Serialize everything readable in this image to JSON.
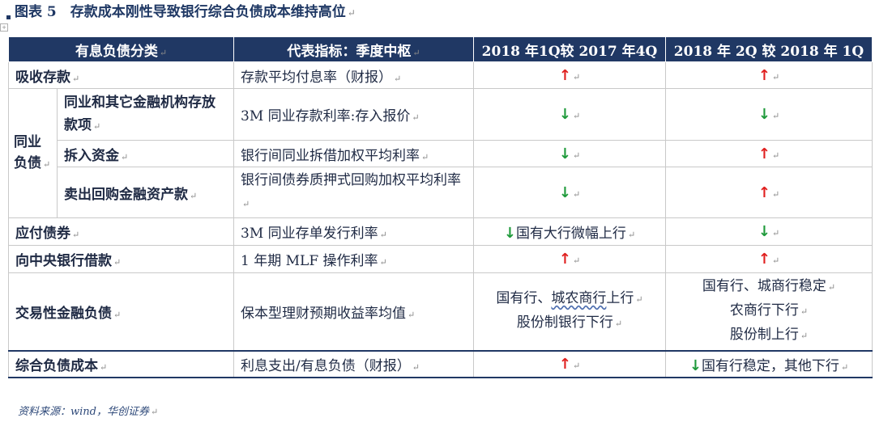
{
  "title": "图表 5　存款成本刚性导致银行综合负债成本维持高位",
  "paragraph_mark": "↵",
  "anchor_mark": "+",
  "header": {
    "col1": "有息负债分类",
    "col2": "代表指标：季度中枢",
    "col3": "2018 年1Q较 2017 年4Q",
    "col4": "2018 年 2Q 较 2018 年 1Q"
  },
  "rows": {
    "deposit": {
      "label": "吸收存款",
      "indicator": "存款平均付息率（财报）",
      "c3": "↑",
      "c4": "↑"
    },
    "interbank_group": "同业负债",
    "interbank_deposit": {
      "label": "同业和其它金融机构存放款项",
      "indicator": "3M 同业存款利率:存入报价",
      "c3": "↓",
      "c4": "↓"
    },
    "borrowing": {
      "label": "拆入资金",
      "indicator": "银行间同业拆借加权平均利率",
      "c3": "↓",
      "c4": "↑"
    },
    "repo": {
      "label": "卖出回购金融资产款",
      "indicator": "银行间债券质押式回购加权平均利率",
      "c3": "↓",
      "c4": "↑"
    },
    "bonds": {
      "label": "应付债券",
      "indicator": "3M 同业存单发行利率",
      "c3_arrow": "↓",
      "c3_text": "国有大行微幅上行",
      "c4": "↓"
    },
    "central_bank": {
      "label": "向中央银行借款",
      "indicator": "1 年期 MLF 操作利率",
      "c3": "↑",
      "c4": "↑"
    },
    "trading": {
      "label": "交易性金融负债",
      "indicator": "保本型理财预期收益率均值",
      "c3_line1_a": "国有行、",
      "c3_line1_b": "城农商行",
      "c3_line1_c": "上行",
      "c3_line2": "股份制银行下行",
      "c4_line1": "国有行、城商行稳定",
      "c4_line2": "农商行下行",
      "c4_line3": "股份制上行"
    },
    "total": {
      "label": "综合负债成本",
      "indicator": "利息支出/有息负债（财报）",
      "c3": "↑",
      "c4_arrow": "↓",
      "c4_text": "国有行稳定，其他下行"
    }
  },
  "source": "资料来源：wind，华创证券",
  "colors": {
    "header_bg": "#203864",
    "up": "#e0201f",
    "down": "#1f9a3b",
    "title": "#1f3864"
  }
}
